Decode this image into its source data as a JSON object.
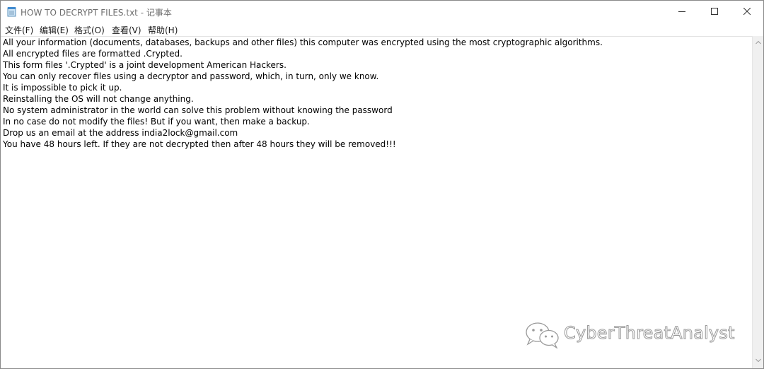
{
  "window": {
    "title": "HOW TO DECRYPT FILES.txt - 记事本",
    "icon": "notepad-icon"
  },
  "controls": {
    "minimize": "minimize-icon",
    "maximize": "maximize-icon",
    "close": "close-icon"
  },
  "menu": {
    "items": [
      "文件(F)",
      "编辑(E)",
      "格式(O)",
      "查看(V)",
      "帮助(H)"
    ]
  },
  "document": {
    "lines": [
      "All your information (documents, databases, backups and other files) this computer was encrypted using the most cryptographic algorithms.",
      "All encrypted files are formatted .Crypted.",
      "This form files '.Crypted' is a joint development American Hackers.",
      "You can only recover files using a decryptor and password, which, in turn, only we know.",
      "It is impossible to pick it up.",
      "Reinstalling the OS will not change anything.",
      "No system administrator in the world can solve this problem without knowing the password",
      "In no case do not modify the files! But if you want, then make a backup.",
      "Drop us an email at the address india2lock@gmail.com",
      "You have 48 hours left. If they are not decrypted then after 48 hours they will be removed!!!"
    ]
  },
  "watermark": {
    "text": "CyberThreatAnalyst",
    "icon": "wechat-icon"
  }
}
